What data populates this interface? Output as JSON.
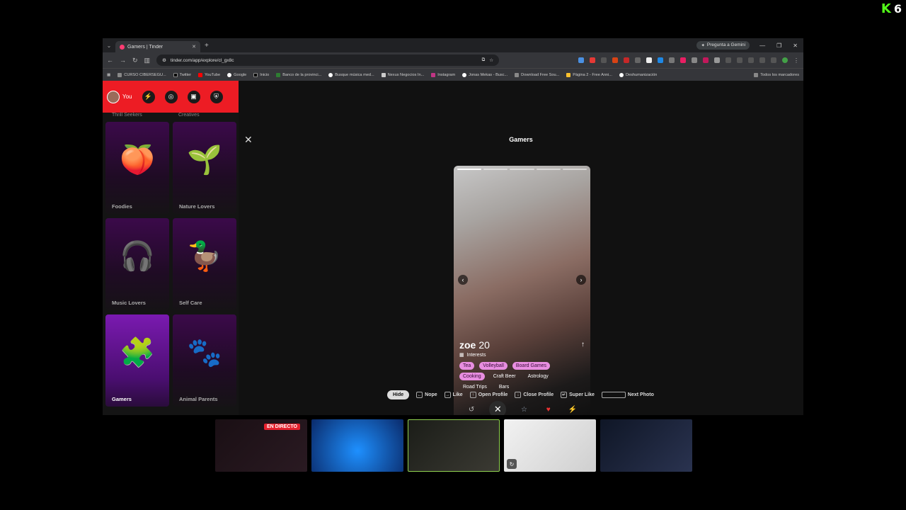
{
  "overlay": {
    "kick_count": "6"
  },
  "browser": {
    "tab_title": "Gamers | Tinder",
    "url": "tinder.com/app/explore/cl_gx8c",
    "gemini": "Pregunta a Gemini",
    "bookmarks": [
      "CURSO CIBERSEGU...",
      "Twitter",
      "YouTube",
      "Google",
      "Inicio",
      "Banco de la provinci...",
      "Busque música med...",
      "Nexus Negocios In...",
      "Instagram",
      "Jonas Mekas - Busc...",
      "Download Free Sou...",
      "Página 2 - Free Anni...",
      "Deshumanización"
    ],
    "all_bookmarks": "Todos los marcadores"
  },
  "sidebar": {
    "you_label": "You",
    "partial_categories": [
      "Thrill Seekers",
      "Creatives"
    ],
    "categories": [
      {
        "label": "Foodies",
        "icon": "🍑"
      },
      {
        "label": "Nature Lovers",
        "icon": "🌱"
      },
      {
        "label": "Music Lovers",
        "icon": "🎧"
      },
      {
        "label": "Self Care",
        "icon": "🦆"
      },
      {
        "label": "Gamers",
        "icon": "🧩"
      },
      {
        "label": "Animal Parents",
        "icon": "🐾"
      }
    ]
  },
  "main": {
    "title": "Gamers",
    "profile": {
      "name": "zoe",
      "age": "20",
      "interests_label": "Interests",
      "interests": [
        {
          "label": "Tea",
          "shared": true
        },
        {
          "label": "Volleyball",
          "shared": true
        },
        {
          "label": "Board Games",
          "shared": true
        },
        {
          "label": "Cooking",
          "shared": true
        },
        {
          "label": "Craft Beer",
          "shared": false
        },
        {
          "label": "Astrology",
          "shared": false
        },
        {
          "label": "Road Trips",
          "shared": false
        },
        {
          "label": "Bars",
          "shared": false
        }
      ]
    },
    "shortcuts": {
      "hide": "Hide",
      "nope": "Nope",
      "like": "Like",
      "open_profile": "Open Profile",
      "close_profile": "Close Profile",
      "super_like": "Super Like",
      "next_photo": "Next Photo"
    }
  },
  "stream": {
    "live_label": "EN DIRECTO"
  },
  "colors": {
    "tinder_red": "#ed1c24",
    "shared_chip": "#e88ee0",
    "kick_green": "#53fc18"
  }
}
